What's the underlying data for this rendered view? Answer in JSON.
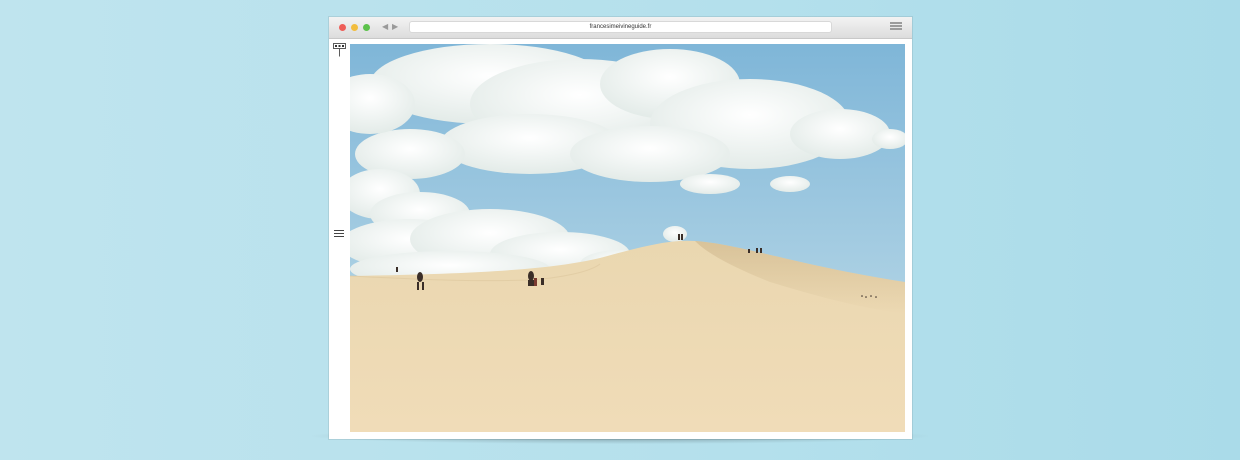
{
  "browser": {
    "url": "francesimeivineguide.fr",
    "back_icon": "arrow-left-icon",
    "forward_icon": "arrow-right-icon",
    "menu_icon": "hamburger-icon"
  },
  "site": {
    "logo_icon": "logo-mark-icon",
    "nav_icon": "hamburger-menu-icon"
  },
  "hero": {
    "scene": "sand-dune-under-cloudy-sky"
  },
  "colors": {
    "background": "#b4e0ec",
    "sky": "#86bfdc",
    "sand": "#e8d4aa",
    "traffic_red": "#ee5e58",
    "traffic_yellow": "#f2bd3e",
    "traffic_green": "#5cc24b"
  }
}
